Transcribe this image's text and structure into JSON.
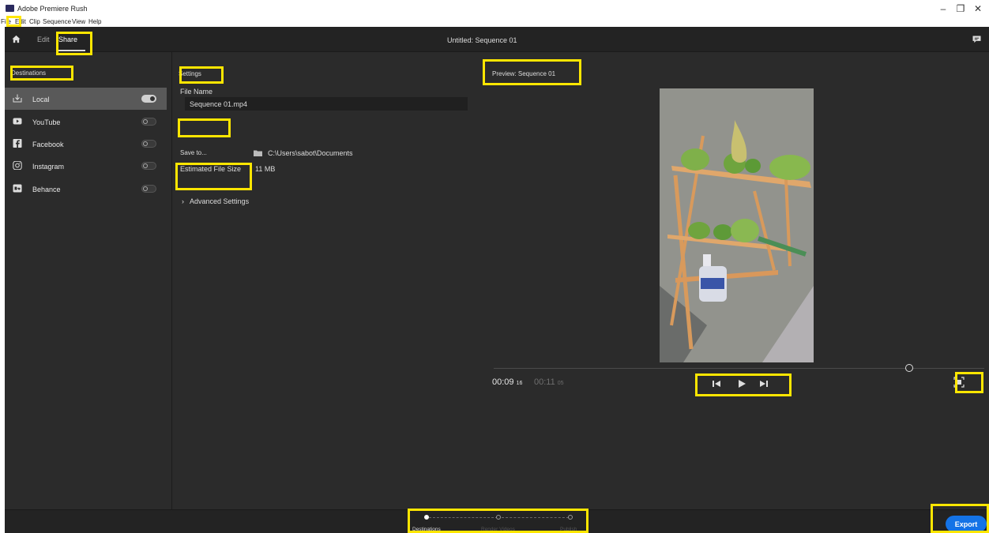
{
  "window": {
    "title": "Adobe Premiere Rush",
    "minimize": "–",
    "restore": "❐",
    "close": "✕"
  },
  "menu": [
    "File",
    "Edit",
    "Clip",
    "Sequence",
    "View",
    "Help"
  ],
  "topbar": {
    "tabs": [
      "Edit",
      "Share"
    ],
    "active_tab": "Share",
    "document_title": "Untitled: Sequence 01"
  },
  "destinations": {
    "title": "Destinations",
    "items": [
      {
        "label": "Local",
        "icon": "local-save-icon",
        "enabled": true
      },
      {
        "label": "YouTube",
        "icon": "youtube-icon",
        "enabled": false
      },
      {
        "label": "Facebook",
        "icon": "facebook-icon",
        "enabled": false
      },
      {
        "label": "Instagram",
        "icon": "instagram-icon",
        "enabled": false
      },
      {
        "label": "Behance",
        "icon": "behance-icon",
        "enabled": false
      }
    ]
  },
  "settings": {
    "title": "Settings",
    "file_name_label": "File Name",
    "file_name_value": "Sequence 01.mp4",
    "save_to_label": "Save to...",
    "save_path": "C:\\Users\\sabot\\Documents",
    "size_label": "Estimated File Size",
    "size_value": "11 MB",
    "advanced_label": "Advanced Settings",
    "advanced_chevron": "›"
  },
  "preview": {
    "title": "Preview: Sequence 01",
    "current_time": "00:09",
    "current_frames": "16",
    "total_time": "00:11",
    "total_frames": "05"
  },
  "steps": [
    {
      "label": "Destinations",
      "active": true
    },
    {
      "label": "Render Videos",
      "active": false
    },
    {
      "label": "Publish",
      "active": false
    }
  ],
  "export_label": "Export",
  "colors": {
    "accent": "#1473e6",
    "highlight": "#ffe600",
    "panel": "#2b2b2b",
    "bar": "#232323"
  }
}
